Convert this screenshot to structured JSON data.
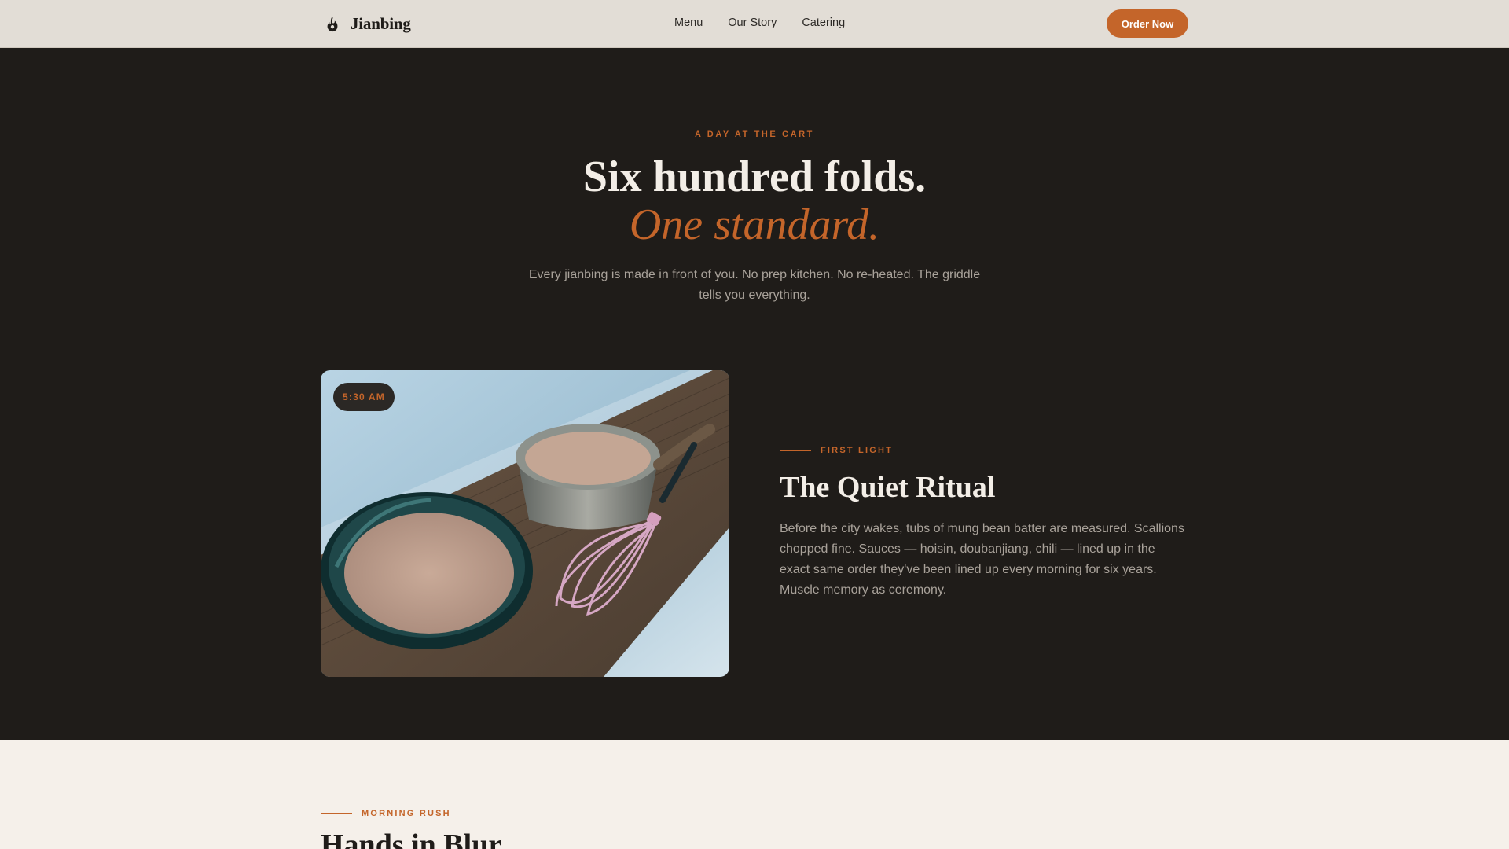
{
  "nav": {
    "brand": "Jianbing",
    "links": [
      "Menu",
      "Our Story",
      "Catering"
    ],
    "order_button": "Order Now"
  },
  "hero": {
    "kicker": "A DAY AT THE CART",
    "title_line1": "Six hundred folds.",
    "title_line2": "One standard.",
    "subtitle": "Every jianbing is made in front of you. No prep kitchen. No re-heated. The griddle tells you everything."
  },
  "feature": {
    "time_badge": "5:30 AM",
    "eyebrow": "FIRST LIGHT",
    "title": "The Quiet Ritual",
    "body": "Before the city wakes, tubs of mung bean batter are measured. Scallions chopped fine. Sauces — hoisin, doubanjiang, chili — lined up in the exact same order they've been lined up every morning for six years. Muscle memory as ceremony."
  },
  "next_section": {
    "eyebrow": "MORNING RUSH",
    "title": "Hands in Blur"
  },
  "colors": {
    "accent": "#c4652a",
    "dark_bg": "#1f1c19",
    "light_bg": "#f5f0ea",
    "nav_bg": "#e2ddd6"
  }
}
